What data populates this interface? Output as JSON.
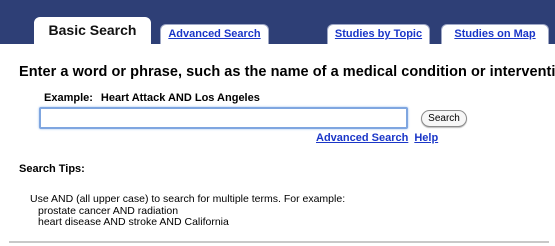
{
  "tabs": [
    {
      "label": "Basic Search",
      "active": true
    },
    {
      "label": "Advanced Search",
      "active": false
    },
    {
      "label": "Studies by Topic",
      "active": false
    },
    {
      "label": "Studies on Map",
      "active": false
    }
  ],
  "colors": {
    "tab_bar": "#2e3f76",
    "link": "#1a36c8",
    "input_focus": "#7fa6e0"
  },
  "heading": "Enter a word or phrase, such as the name of a medical condition or intervention.",
  "example": {
    "label": "Example:",
    "text": "Heart Attack AND Los Angeles"
  },
  "search": {
    "value": "",
    "placeholder": "",
    "button_label": "Search"
  },
  "links": {
    "advanced": "Advanced Search",
    "help": "Help"
  },
  "tips": {
    "heading": "Search Tips:",
    "intro": "Use AND (all upper case) to search for multiple terms. For example:",
    "examples": [
      "prostate cancer AND radiation",
      "heart disease AND stroke AND California"
    ]
  }
}
